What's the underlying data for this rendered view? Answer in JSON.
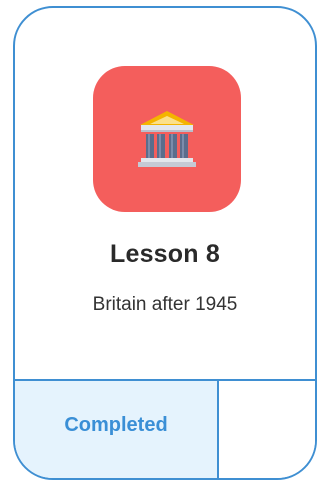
{
  "lesson_card": {
    "icon": "classical-building-icon",
    "title": "Lesson 8",
    "subtitle": "Britain after 1945",
    "status": "Completed"
  },
  "colors": {
    "border": "#3f8fd2",
    "icon_tile": "#f45e5c",
    "status_bg": "#e5f3fd",
    "status_text": "#3a8fd6"
  }
}
